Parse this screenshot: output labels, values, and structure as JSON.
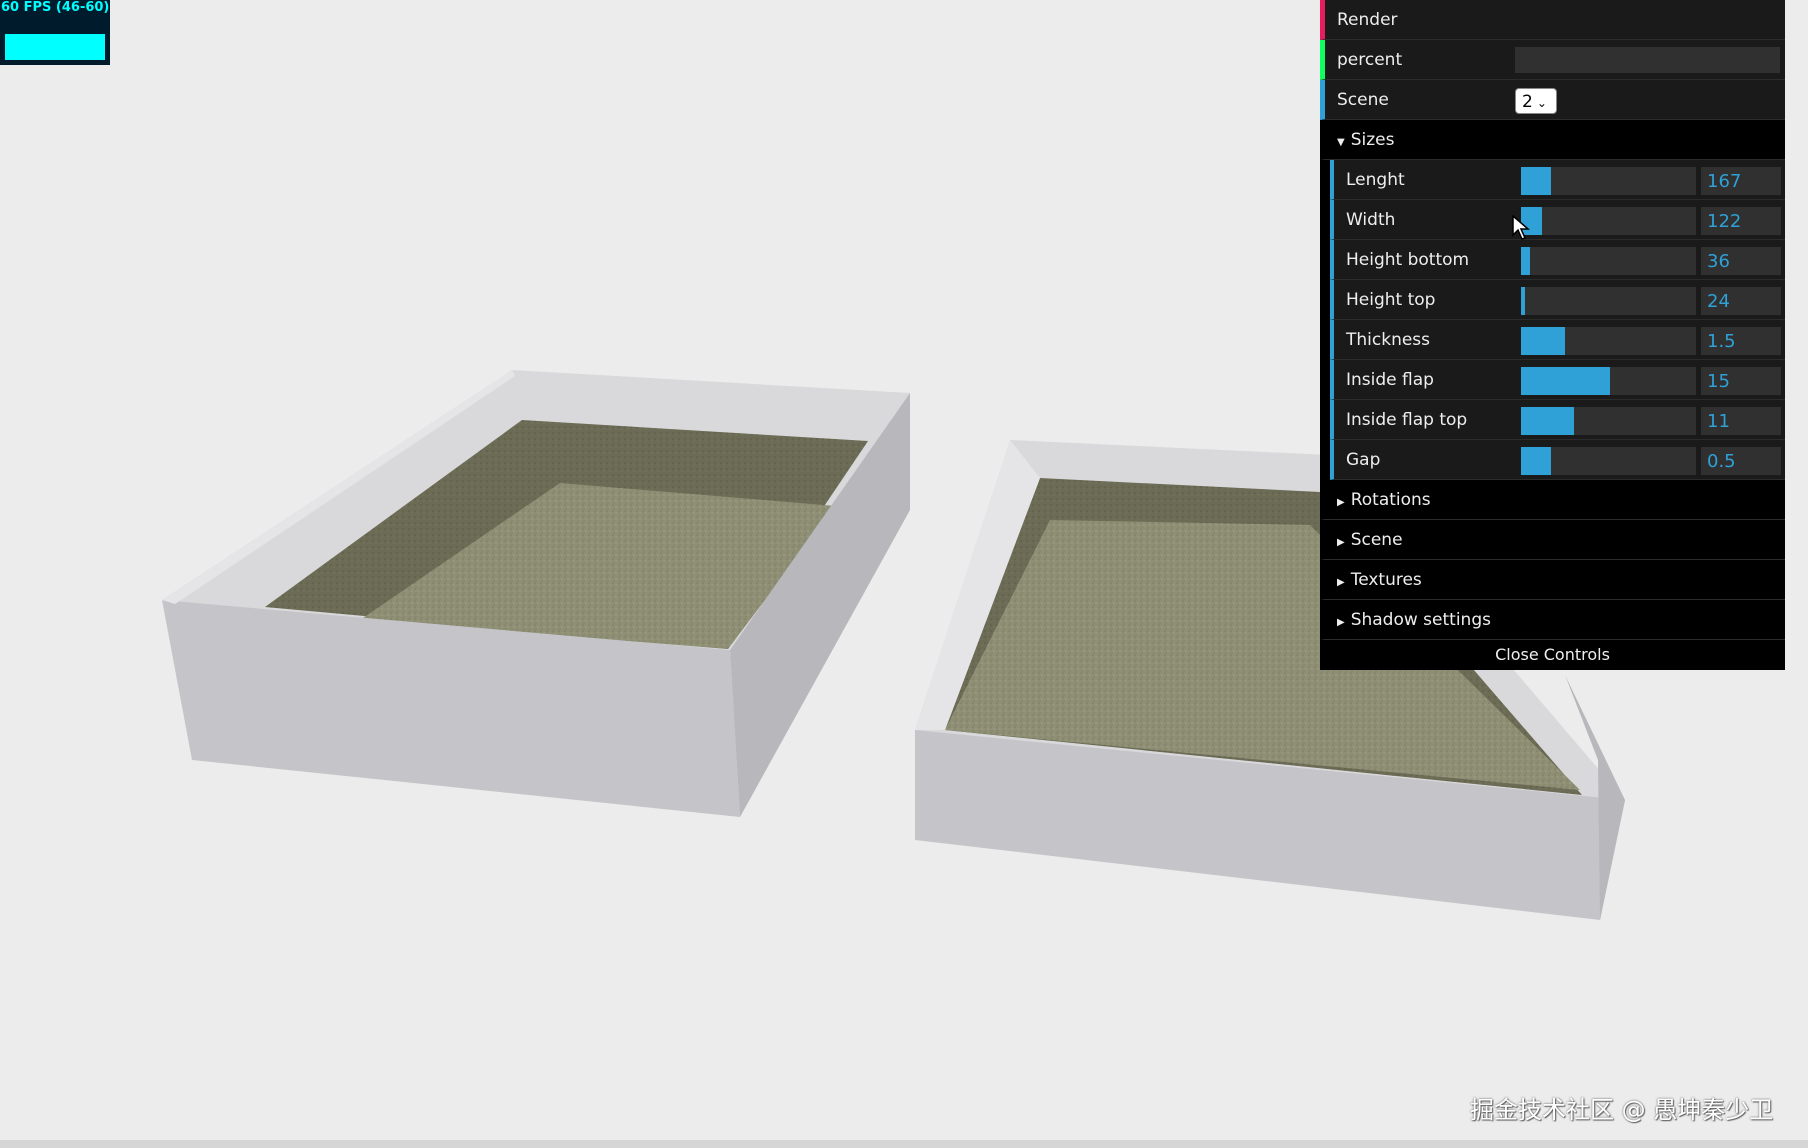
{
  "stats": {
    "fps_text": "60 FPS (46-60)"
  },
  "gui": {
    "render_label": "Render",
    "percent_label": "percent",
    "scene_label": "Scene",
    "scene_value": "2",
    "sizes_folder": "Sizes",
    "sizes": [
      {
        "label": "Lenght",
        "value": "167",
        "fill": 0.17
      },
      {
        "label": "Width",
        "value": "122",
        "fill": 0.12
      },
      {
        "label": "Height bottom",
        "value": "36",
        "fill": 0.05
      },
      {
        "label": "Height top",
        "value": "24",
        "fill": 0.02
      },
      {
        "label": "Thickness",
        "value": "1.5",
        "fill": 0.25
      },
      {
        "label": "Inside flap",
        "value": "15",
        "fill": 0.51
      },
      {
        "label": "Inside flap top",
        "value": "11",
        "fill": 0.3
      },
      {
        "label": "Gap",
        "value": "0.5",
        "fill": 0.17
      }
    ],
    "folders": [
      "Rotations",
      "Scene",
      "Textures",
      "Shadow settings"
    ],
    "close_label": "Close Controls",
    "accent": "#2fa1d6"
  },
  "watermark": "掘金技术社区 @ 愚坤秦少卫"
}
